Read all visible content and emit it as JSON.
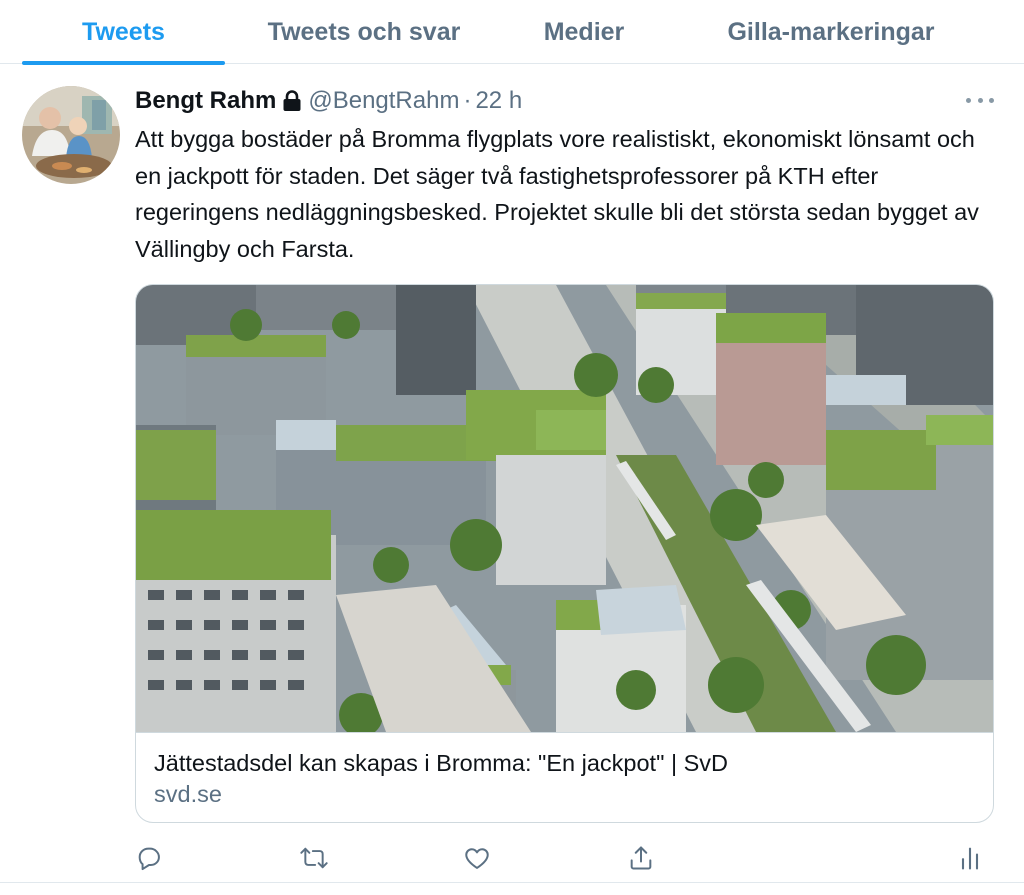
{
  "tabs": [
    {
      "label": "Tweets",
      "active": true
    },
    {
      "label": "Tweets och svar",
      "active": false
    },
    {
      "label": "Medier",
      "active": false
    },
    {
      "label": "Gilla-markeringar",
      "active": false
    }
  ],
  "tweet": {
    "author_name": "Bengt Rahm",
    "handle": "@BengtRahm",
    "separator": "·",
    "time": "22 h",
    "protected_icon": "lock-icon",
    "text": "Att bygga bostäder på Bromma flygplats vore realistiskt, ekonomiskt lönsamt och en jackpott för staden. Det säger två fastighetsprofessorer på KTH efter regeringens nedläggningsbesked. Projektet skulle bli det största sedan bygget av Vällingby och Farsta.",
    "card": {
      "title": "Jättestadsdel kan skapas i Bromma: \"En jackpot\" | SvD",
      "domain": "svd.se"
    },
    "actions": [
      "reply-icon",
      "retweet-icon",
      "like-icon",
      "share-icon",
      "analytics-icon"
    ]
  },
  "colors": {
    "accent": "#1d9bf0",
    "secondary_text": "#5b7083",
    "icon": "#5b7083",
    "border": "#e1e8ed"
  }
}
